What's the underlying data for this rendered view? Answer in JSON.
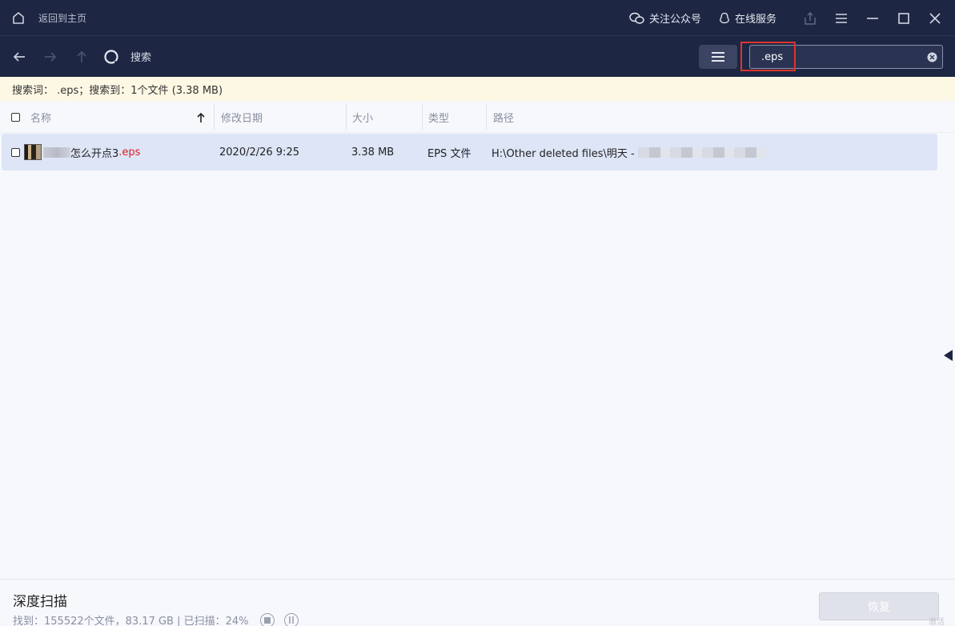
{
  "titlebar": {
    "home_label": "返回到主页",
    "follow_label": "关注公众号",
    "service_label": "在线服务"
  },
  "toolbar": {
    "search_label": "搜索",
    "search_value": ".eps"
  },
  "infobar": {
    "text": "搜索词：  .eps；搜索到：1个文件 (3.38 MB)"
  },
  "table": {
    "columns": {
      "name": "名称",
      "modified": "修改日期",
      "size": "大小",
      "type": "类型",
      "path": "路径"
    },
    "rows": [
      {
        "name_visible": "怎么开点3",
        "extension": ".eps",
        "modified": "2020/2/26 9:25",
        "size": "3.38 MB",
        "type": "EPS 文件",
        "path_visible": "H:\\Other deleted files\\明天 -"
      }
    ]
  },
  "footer": {
    "scan_title": "深度扫描",
    "scan_status": "找到：155522个文件，83.17 GB | 已扫描：24%",
    "recover_label": "恢复",
    "watermark": "激活"
  },
  "colors": {
    "header_bg": "#1d2744",
    "row_selected": "#dde5f7",
    "highlight": "#e0332b",
    "extension": "#e01d1d"
  }
}
